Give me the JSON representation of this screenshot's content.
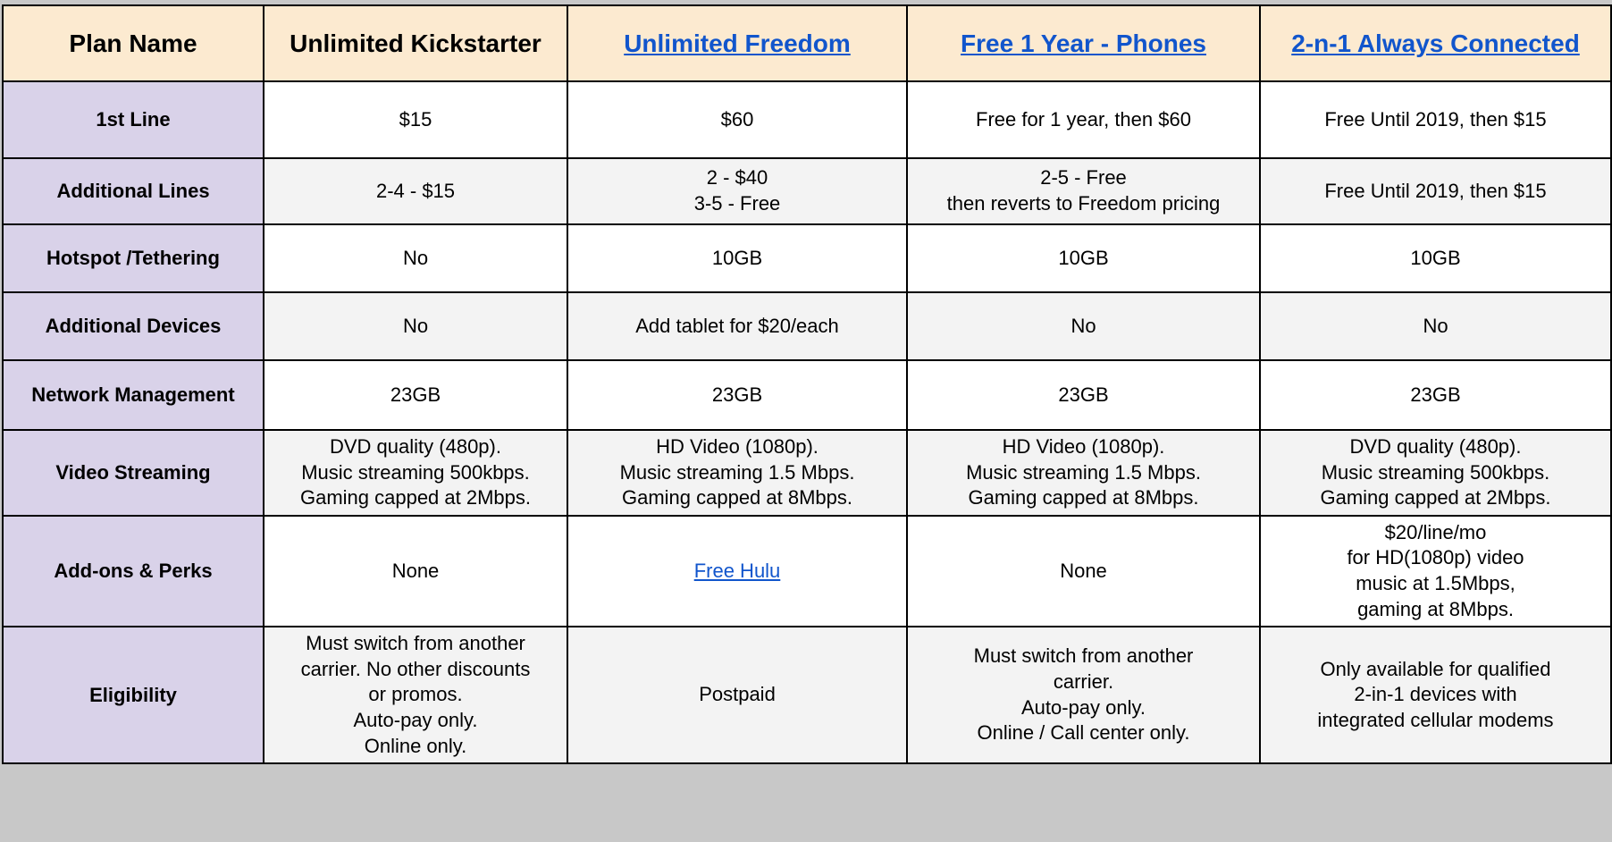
{
  "table": {
    "header": {
      "label_column": {
        "text": "Plan Name",
        "style": "plain"
      },
      "columns": [
        {
          "text": "Unlimited Kickstarter",
          "style": "plain",
          "is_link": false
        },
        {
          "text": "Unlimited Freedom",
          "style": "link",
          "is_link": true
        },
        {
          "text": "Free 1 Year - Phones",
          "style": "link",
          "is_link": true
        },
        {
          "text": "2-n-1 Always Connected",
          "style": "link",
          "is_link": true
        }
      ]
    },
    "rows": [
      {
        "label": "1st Line",
        "shade": "white",
        "cells": [
          {
            "text": "$15"
          },
          {
            "text": "$60"
          },
          {
            "text": "Free for 1 year, then $60"
          },
          {
            "text": "Free Until 2019, then $15"
          }
        ]
      },
      {
        "label": "Additional Lines",
        "shade": "grey",
        "cells": [
          {
            "text": "2-4 - $15"
          },
          {
            "text": "2 - $40\n3-5 - Free"
          },
          {
            "text": "2-5 - Free\nthen reverts to Freedom pricing"
          },
          {
            "text": "Free Until 2019, then $15"
          }
        ]
      },
      {
        "label": "Hotspot /Tethering",
        "shade": "white",
        "cells": [
          {
            "text": "No"
          },
          {
            "text": "10GB"
          },
          {
            "text": "10GB"
          },
          {
            "text": "10GB"
          }
        ]
      },
      {
        "label": "Additional Devices",
        "shade": "grey",
        "cells": [
          {
            "text": "No"
          },
          {
            "text": "Add tablet for $20/each"
          },
          {
            "text": "No"
          },
          {
            "text": "No"
          }
        ]
      },
      {
        "label": "Network Management",
        "shade": "white",
        "cells": [
          {
            "text": "23GB"
          },
          {
            "text": "23GB"
          },
          {
            "text": "23GB"
          },
          {
            "text": "23GB"
          }
        ]
      },
      {
        "label": "Video Streaming",
        "shade": "grey",
        "cells": [
          {
            "text": "DVD quality (480p).\nMusic streaming 500kbps.\nGaming capped at 2Mbps."
          },
          {
            "text": "HD Video (1080p).\nMusic streaming 1.5 Mbps.\nGaming capped at 8Mbps."
          },
          {
            "text": "HD Video (1080p).\nMusic streaming 1.5 Mbps.\nGaming capped at 8Mbps."
          },
          {
            "text": "DVD quality (480p).\nMusic streaming 500kbps.\nGaming capped at 2Mbps."
          }
        ]
      },
      {
        "label": "Add-ons & Perks",
        "shade": "white",
        "cells": [
          {
            "text": "None"
          },
          {
            "text": "Free Hulu ",
            "is_link": true
          },
          {
            "text": "None"
          },
          {
            "text": "$20/line/mo\nfor HD(1080p) video\nmusic at 1.5Mbps,\ngaming at 8Mbps."
          }
        ]
      },
      {
        "label": "Eligibility",
        "shade": "grey",
        "cells": [
          {
            "text": "Must switch from another\ncarrier. No other discounts\nor promos.\nAuto-pay only.\nOnline only."
          },
          {
            "text": "Postpaid"
          },
          {
            "text": "Must switch from another\ncarrier.\nAuto-pay only.\nOnline / Call center only."
          },
          {
            "text": "Only available for qualified\n2-in-1 devices with\nintegrated cellular modems"
          }
        ]
      }
    ]
  },
  "colors": {
    "header_background": "#fcead0",
    "row_label_background": "#d9d2e9",
    "cell_white": "#ffffff",
    "cell_grey": "#f3f3f3",
    "link": "#1155cc",
    "border": "#000000",
    "canvas": "#c8c8c8"
  }
}
